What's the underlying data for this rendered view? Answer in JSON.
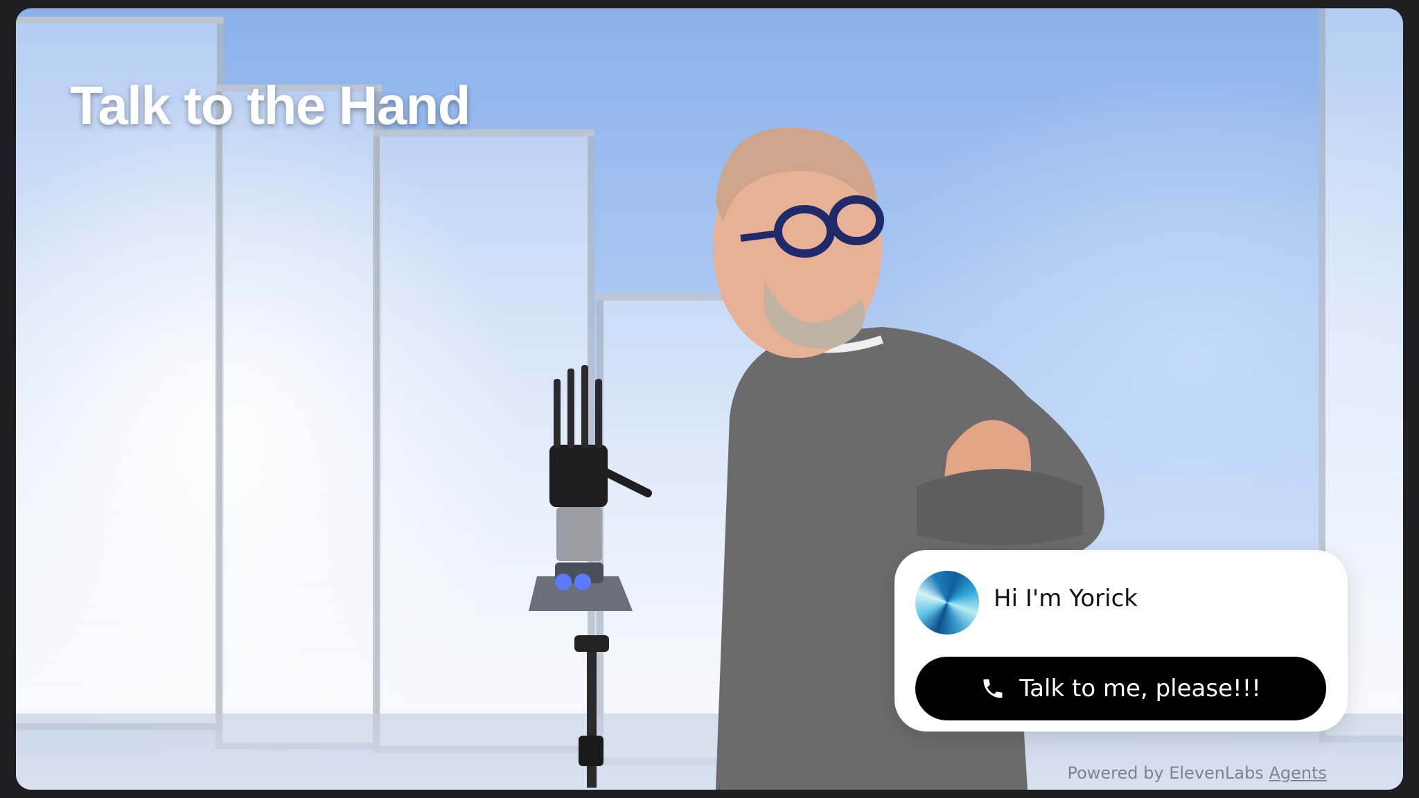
{
  "page": {
    "title": "Talk to the Hand"
  },
  "widget": {
    "greeting": "Hi I'm Yorick",
    "call_button_label": "Talk to me, please!!!",
    "avatar_icon": "gradient-orb-icon",
    "call_icon": "phone-icon"
  },
  "footer": {
    "powered_prefix": "Powered by ElevenLabs",
    "powered_link": "Agents"
  },
  "colors": {
    "background": "#1f1f21",
    "sky": "#a9c6f2",
    "button": "#000000",
    "card": "#ffffff"
  }
}
